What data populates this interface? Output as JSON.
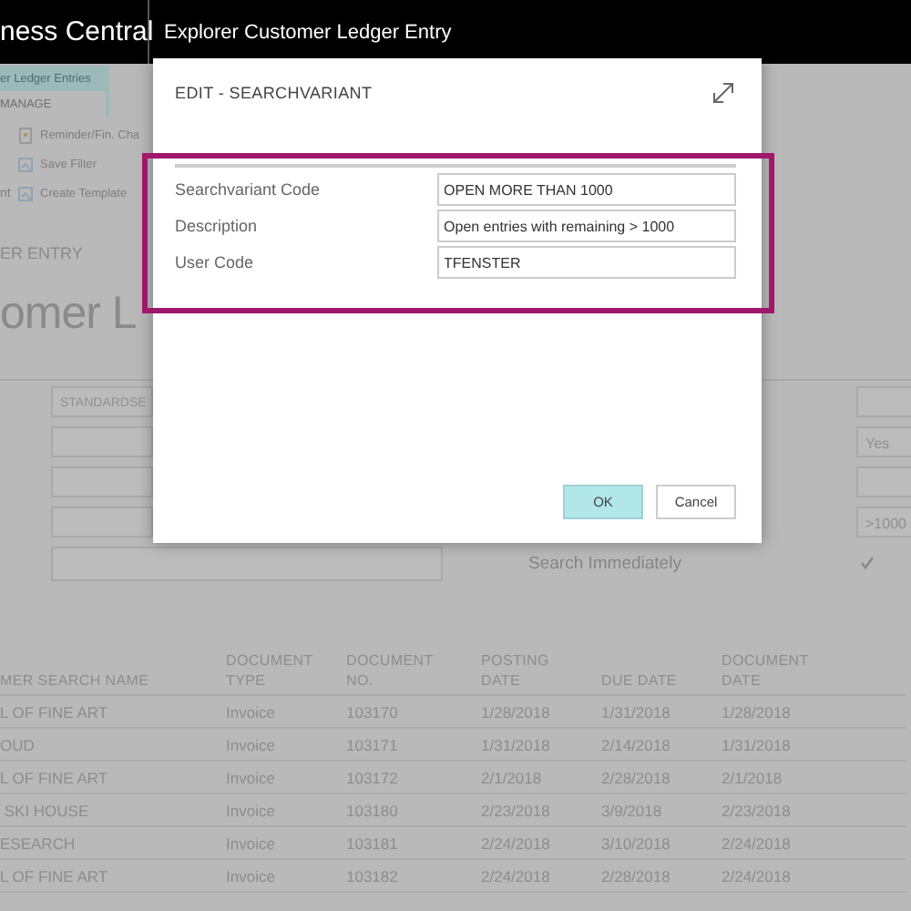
{
  "app_bar": {
    "product": "ness Central",
    "page_title": "Explorer Customer Ledger Entry"
  },
  "background_page": {
    "tab": "er Ledger Entries",
    "section": "MANAGE",
    "actions": [
      {
        "label": "Reminder/Fin. Cha",
        "kind": "document"
      },
      {
        "label": "Save Filter",
        "kind": "filter"
      },
      {
        "label": "Create Template",
        "kind": "filter",
        "cut_prefix": "nt"
      }
    ],
    "caption": "ER ENTRY",
    "heading": "omer L",
    "filters": [
      {
        "left": {
          "kind": "field",
          "value": "STANDARDSE"
        },
        "right": {
          "kind": "field"
        }
      },
      {
        "left": {
          "kind": "field"
        },
        "right": {
          "kind": "field",
          "value": "Yes"
        }
      },
      {
        "left": {
          "kind": "field"
        },
        "right": {
          "kind": "field"
        }
      },
      {
        "left": {
          "kind": "field"
        },
        "right": {
          "kind": "field",
          "value": ">1000"
        }
      },
      {
        "left": {
          "kind": "wide"
        },
        "label": "Search Immediately",
        "right": {
          "kind": "checkbox",
          "checked": true
        }
      }
    ],
    "table": {
      "columns": [
        "MER SEARCH NAME",
        "DOCUMENT\nTYPE",
        "DOCUMENT\nNO.",
        "POSTING\nDATE",
        "DUE DATE",
        "DOCUMENT\nDATE"
      ],
      "rows": [
        [
          "L OF FINE ART",
          "Invoice",
          "103170",
          "1/28/2018",
          "1/31/2018",
          "1/28/2018"
        ],
        [
          "OUD",
          "Invoice",
          "103171",
          "1/31/2018",
          "2/14/2018",
          "1/31/2018"
        ],
        [
          "L OF FINE ART",
          "Invoice",
          "103172",
          "2/1/2018",
          "2/28/2018",
          "2/1/2018"
        ],
        [
          " SKI HOUSE",
          "Invoice",
          "103180",
          "2/23/2018",
          "3/9/2018",
          "2/23/2018"
        ],
        [
          "ESEARCH",
          "Invoice",
          "103181",
          "2/24/2018",
          "3/10/2018",
          "2/24/2018"
        ],
        [
          "L OF FINE ART",
          "Invoice",
          "103182",
          "2/24/2018",
          "2/28/2018",
          "2/24/2018"
        ]
      ]
    }
  },
  "dialog": {
    "title": "EDIT - SEARCHVARIANT",
    "highlighted": true,
    "fields": [
      {
        "label": "Searchvariant Code",
        "value": "OPEN MORE THAN 1000"
      },
      {
        "label": "Description",
        "value": "Open entries with remaining > 1000"
      },
      {
        "label": "User Code",
        "value": "TFENSTER"
      }
    ],
    "buttons": [
      {
        "label": "OK",
        "kind": "primary"
      },
      {
        "label": "Cancel",
        "kind": "secondary"
      }
    ]
  }
}
